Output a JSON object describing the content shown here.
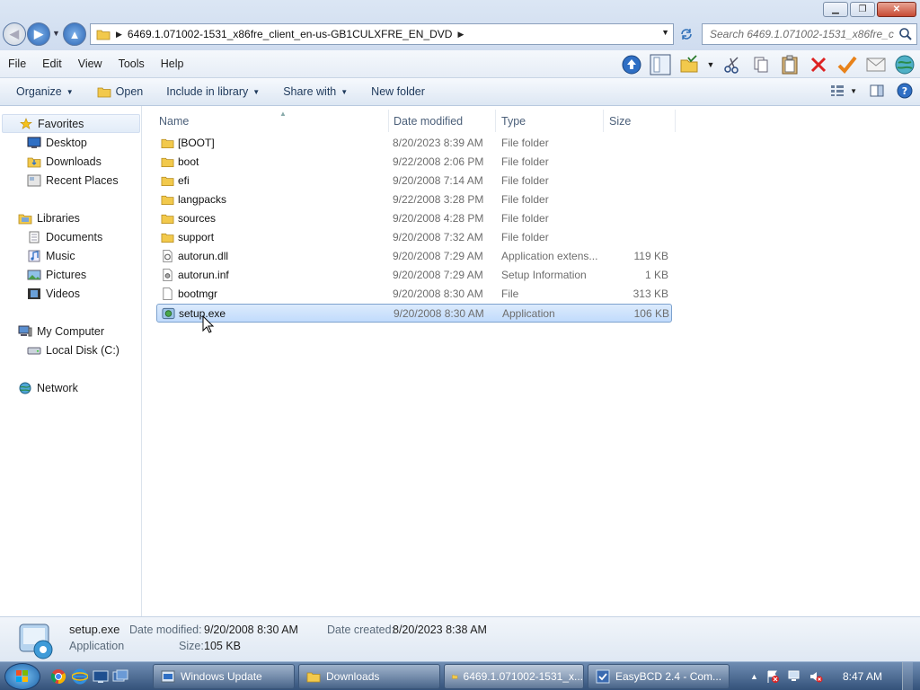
{
  "window": {
    "minimize_glyph": "▁",
    "maximize_glyph": "❐",
    "close_glyph": "✕"
  },
  "address": {
    "path": "6469.1.071002-1531_x86fre_client_en-us-GB1CULXFRE_EN_DVD"
  },
  "search": {
    "placeholder": "Search 6469.1.071002-1531_x86fre_clie..."
  },
  "menu": {
    "items": [
      "File",
      "Edit",
      "View",
      "Tools",
      "Help"
    ]
  },
  "commands": {
    "organize": "Organize",
    "open": "Open",
    "include_in_library": "Include in library",
    "share_with": "Share with",
    "new_folder": "New folder"
  },
  "navpane": {
    "favorites": "Favorites",
    "desktop": "Desktop",
    "downloads": "Downloads",
    "recent_places": "Recent Places",
    "libraries": "Libraries",
    "documents": "Documents",
    "music": "Music",
    "pictures": "Pictures",
    "videos": "Videos",
    "my_computer": "My Computer",
    "local_disk": "Local Disk (C:)",
    "network": "Network"
  },
  "columns": {
    "name": "Name",
    "date_modified": "Date modified",
    "type": "Type",
    "size": "Size"
  },
  "files": [
    {
      "name": "[BOOT]",
      "date": "8/20/2023 8:39 AM",
      "type": "File folder",
      "size": "",
      "icon": "folder-icon"
    },
    {
      "name": "boot",
      "date": "9/22/2008 2:06 PM",
      "type": "File folder",
      "size": "",
      "icon": "folder-icon"
    },
    {
      "name": "efi",
      "date": "9/20/2008 7:14 AM",
      "type": "File folder",
      "size": "",
      "icon": "folder-icon"
    },
    {
      "name": "langpacks",
      "date": "9/22/2008 3:28 PM",
      "type": "File folder",
      "size": "",
      "icon": "folder-icon"
    },
    {
      "name": "sources",
      "date": "9/20/2008 4:28 PM",
      "type": "File folder",
      "size": "",
      "icon": "folder-icon"
    },
    {
      "name": "support",
      "date": "9/20/2008 7:32 AM",
      "type": "File folder",
      "size": "",
      "icon": "folder-icon"
    },
    {
      "name": "autorun.dll",
      "date": "9/20/2008 7:29 AM",
      "type": "Application extens...",
      "size": "119 KB",
      "icon": "dll-file-icon"
    },
    {
      "name": "autorun.inf",
      "date": "9/20/2008 7:29 AM",
      "type": "Setup Information",
      "size": "1 KB",
      "icon": "inf-file-icon"
    },
    {
      "name": "bootmgr",
      "date": "9/20/2008 8:30 AM",
      "type": "File",
      "size": "313 KB",
      "icon": "file-icon"
    },
    {
      "name": "setup.exe",
      "date": "9/20/2008 8:30 AM",
      "type": "Application",
      "size": "106 KB",
      "icon": "setup-app-icon"
    }
  ],
  "details": {
    "filename": "setup.exe",
    "filetype": "Application",
    "date_modified_label": "Date modified:",
    "date_modified_value": "9/20/2008 8:30 AM",
    "date_created_label": "Date created:",
    "date_created_value": "8/20/2023 8:38 AM",
    "size_label": "Size:",
    "size_value": "105 KB"
  },
  "taskbar": {
    "tasks": [
      "Windows Update",
      "Downloads",
      "6469.1.071002-1531_x...",
      "EasyBCD 2.4 - Com..."
    ],
    "clock": "8:47 AM"
  }
}
